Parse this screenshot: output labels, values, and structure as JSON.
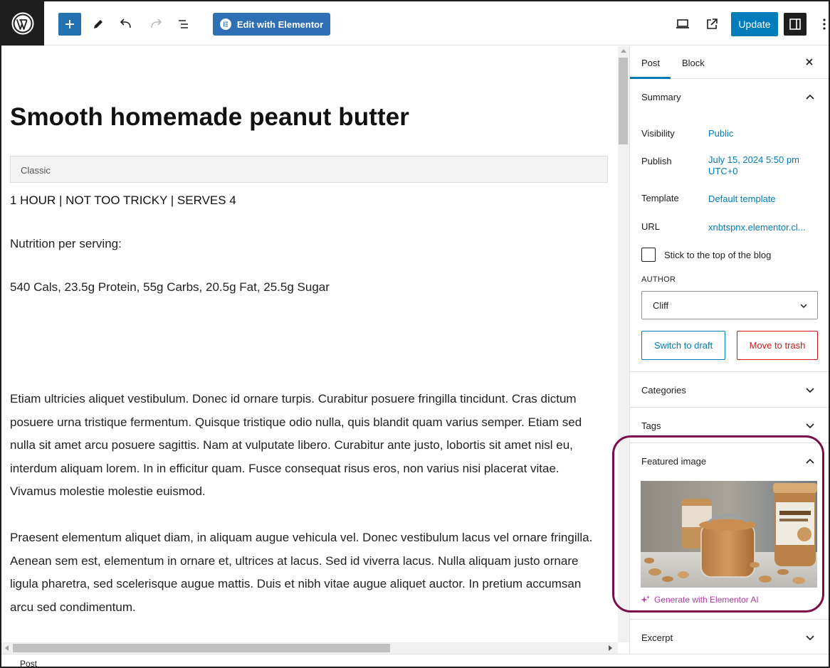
{
  "toolbar": {
    "elementor_label": "Edit with Elementor",
    "update_label": "Update"
  },
  "post": {
    "title": "Smooth homemade peanut butter",
    "block_type": "Classic",
    "meta_line": "1 HOUR | NOT TOO TRICKY | SERVES 4",
    "nutrition_label": "Nutrition per serving:",
    "nutrition_values": "540 Cals, 23.5g Protein, 55g Carbs, 20.5g Fat, 25.5g Sugar",
    "paragraph1": "Etiam ultricies aliquet vestibulum. Donec id ornare turpis. Curabitur posuere fringilla tincidunt. Cras dictum posuere urna tristique fermentum. Quisque tristique odio nulla, quis blandit quam varius semper. Etiam sed nulla sit amet arcu posuere sagittis. Nam at vulputate libero. Curabitur ante justo, lobortis sit amet nisl eu, interdum aliquam lorem. In in efficitur quam. Fusce consequat risus eros, non varius nisi placerat vitae. Vivamus molestie molestie euismod.",
    "paragraph2": "Praesent elementum aliquet diam, in aliquam augue vehicula vel. Donec vestibulum lacus vel ornare fringilla. Aenean sem est, elementum in ornare et, ultrices at lacus. Sed id viverra lacus. Nulla aliquam justo ornare ligula pharetra, sed scelerisque augue mattis. Duis et nibh vitae augue aliquet auctor. In pretium accumsan arcu sed condimentum."
  },
  "status_bar": {
    "label": "Post"
  },
  "sidebar": {
    "tabs": [
      {
        "label": "Post"
      },
      {
        "label": "Block"
      }
    ],
    "summary": {
      "title": "Summary",
      "visibility_label": "Visibility",
      "visibility_value": "Public",
      "publish_label": "Publish",
      "publish_value_line1": "July 15, 2024 5:50 pm",
      "publish_value_line2": "UTC+0",
      "template_label": "Template",
      "template_value": "Default template",
      "url_label": "URL",
      "url_value": "xnbtspnx.elementor.cl...",
      "sticky_label": "Stick to the top of the blog",
      "author_label": "AUTHOR",
      "author_value": "Cliff",
      "switch_draft_label": "Switch to draft",
      "trash_label": "Move to trash"
    },
    "categories_title": "Categories",
    "tags_title": "Tags",
    "featured": {
      "title": "Featured image",
      "generate_label": "Generate with Elementor AI"
    },
    "excerpt_title": "Excerpt"
  },
  "colors": {
    "accent": "#007cba",
    "danger": "#cc1818",
    "ai": "#b23ca1",
    "highlight": "#7b0e48"
  }
}
